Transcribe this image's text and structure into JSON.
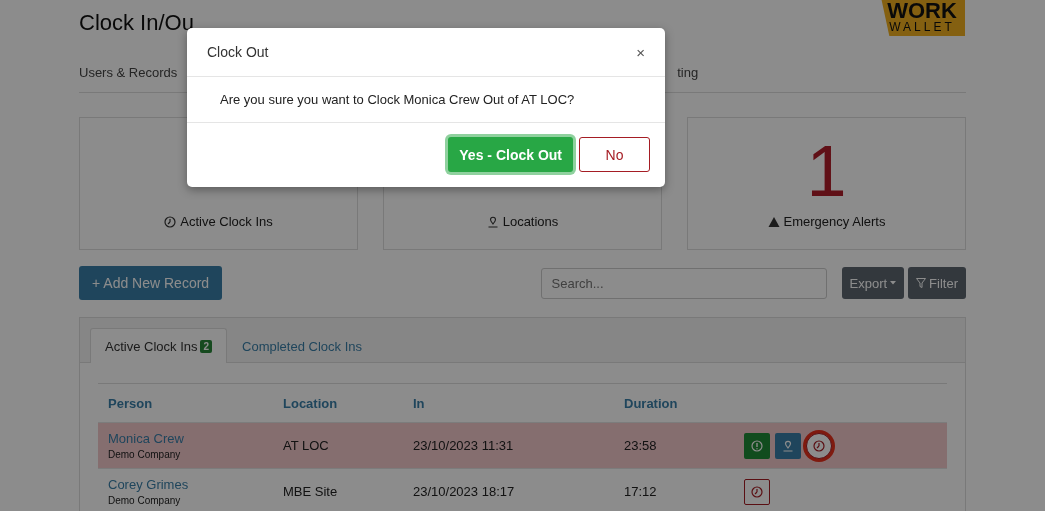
{
  "logo": {
    "top": "WORK",
    "bottom": "WALLET"
  },
  "page": {
    "title": "Clock In/Ou"
  },
  "nav": [
    {
      "label": "Users & Records",
      "selected": false
    },
    {
      "label": "ting",
      "selected": false
    }
  ],
  "stats": [
    {
      "label": "Active Clock Ins",
      "kind": "clock"
    },
    {
      "label": "Locations",
      "kind": "pin"
    },
    {
      "value": "1",
      "label": "Emergency Alerts",
      "kind": "warning",
      "alert": true
    }
  ],
  "toolbar": {
    "add_button": "+ Add New Record",
    "search": {
      "placeholder": "Search..."
    },
    "export_button": "Export",
    "filter_button": "Filter"
  },
  "tabs": [
    {
      "label": "Active Clock Ins",
      "badge": "2",
      "selected": true
    },
    {
      "label": "Completed Clock Ins",
      "selected": false
    }
  ],
  "table": {
    "columns": [
      "Person",
      "Location",
      "In",
      "Duration"
    ],
    "rows": [
      {
        "person": "Monica Crew",
        "company": "Demo Company",
        "location": "AT LOC",
        "in": "23/10/2023 11:31",
        "duration": "23:58",
        "selected": true,
        "actions": [
          {
            "kind": "emergency"
          },
          {
            "kind": "location"
          },
          {
            "kind": "clockout"
          }
        ]
      },
      {
        "person": "Corey Grimes",
        "company": "Demo Company",
        "location": "MBE Site",
        "in": "23/10/2023 18:17",
        "duration": "17:12",
        "selected": false,
        "actions": [
          {
            "kind": "clockout"
          }
        ]
      }
    ]
  },
  "dialog": {
    "title": "Clock Out",
    "close": "×",
    "message": "Are you sure you want to Clock Monica Crew Out of AT LOC?",
    "confirm": "Yes - Clock Out",
    "cancel": "No"
  }
}
